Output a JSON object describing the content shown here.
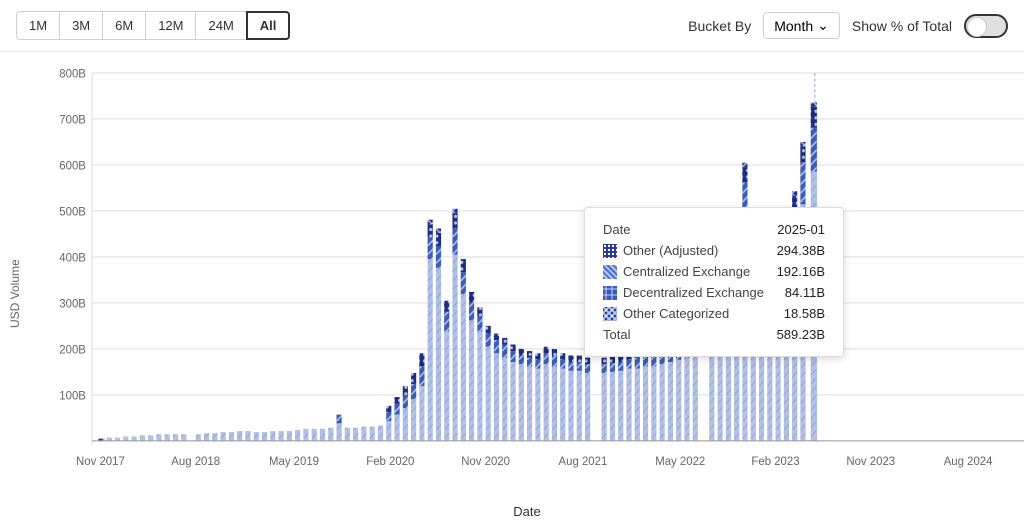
{
  "toolbar": {
    "time_filters": [
      "1M",
      "3M",
      "6M",
      "12M",
      "24M",
      "All"
    ],
    "active_filter": "All",
    "bucket_by_label": "Bucket By",
    "month_label": "Month",
    "show_pct_label": "Show % of Total",
    "toggle_state": false
  },
  "chart": {
    "y_axis_label": "USD Volume",
    "x_axis_label": "Date",
    "y_ticks": [
      "800B",
      "700B",
      "600B",
      "500B",
      "400B",
      "300B",
      "200B",
      "100B"
    ],
    "x_ticks": [
      "Nov 2017",
      "Aug 2018",
      "May 2019",
      "Feb 2020",
      "Nov 2020",
      "Aug 2021",
      "May 2022",
      "Feb 2023",
      "Nov 2023",
      "Aug 2024"
    ]
  },
  "tooltip": {
    "date_label": "Date",
    "date_value": "2025-01",
    "rows": [
      {
        "label": "Other (Adjusted)",
        "value": "294.38B",
        "pattern": "dots"
      },
      {
        "label": "Centralized Exchange",
        "value": "192.16B",
        "pattern": "hatch"
      },
      {
        "label": "Decentralized Exchange",
        "value": "84.11B",
        "pattern": "cross"
      },
      {
        "label": "Other Categorized",
        "value": "18.58B",
        "pattern": "xcross"
      }
    ],
    "total_label": "Total",
    "total_value": "589.23B"
  }
}
